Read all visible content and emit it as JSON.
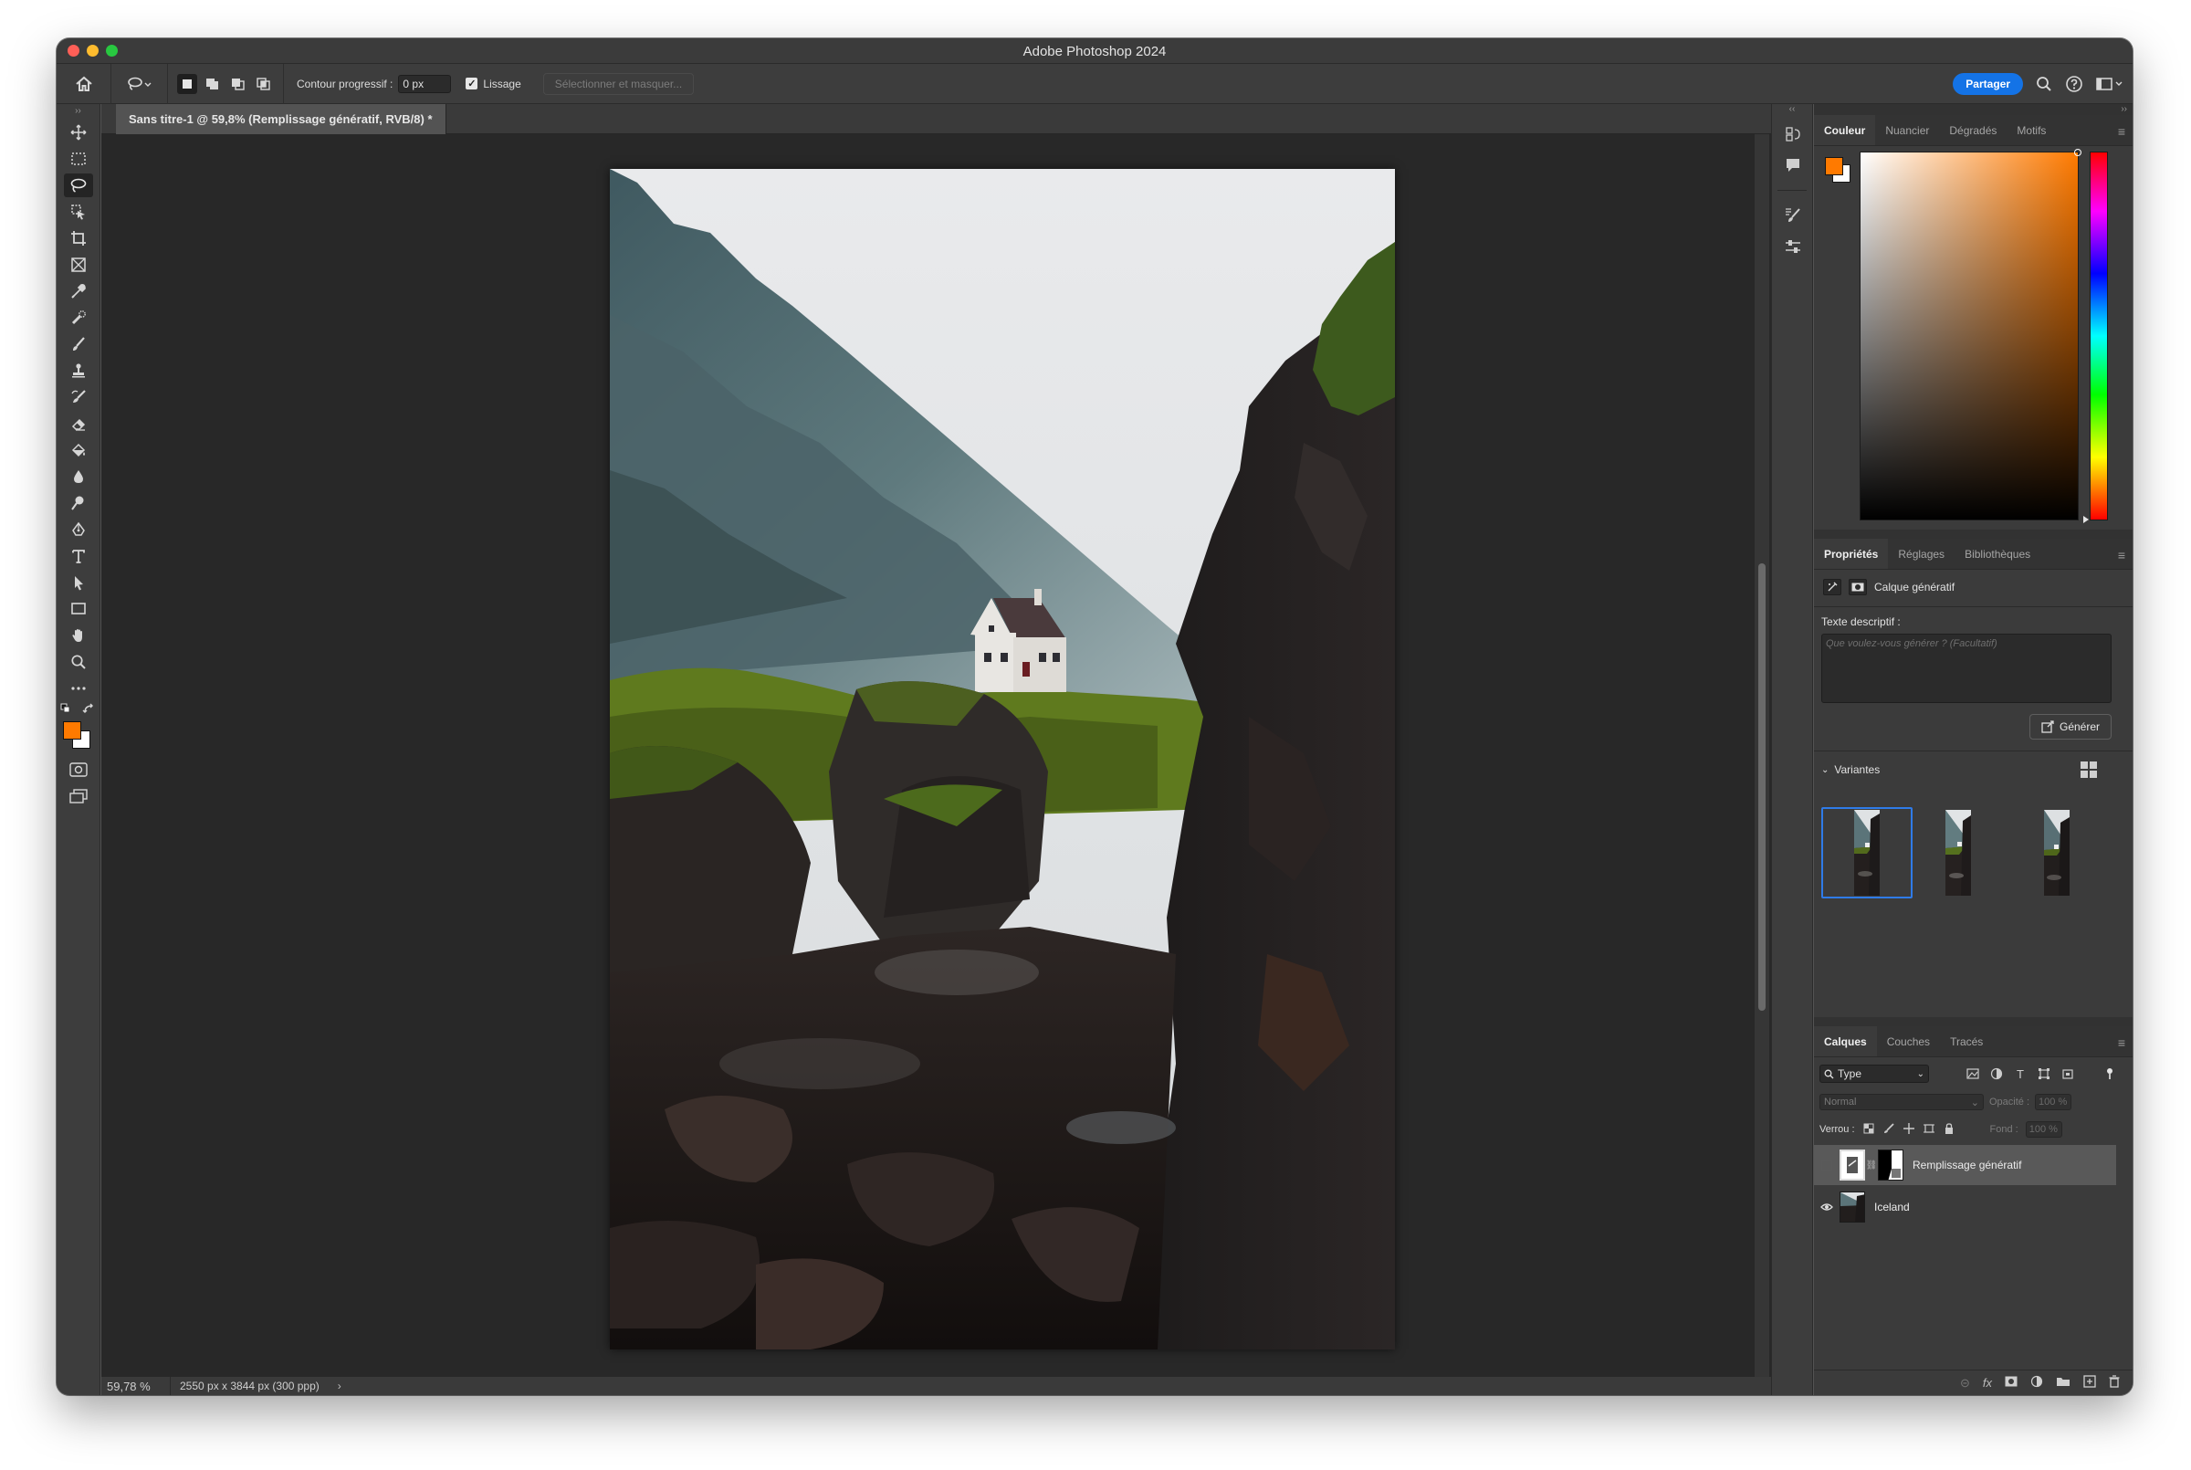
{
  "app": {
    "window_title": "Adobe Photoshop 2024"
  },
  "options_bar": {
    "feather_label": "Contour progressif :",
    "feather_value": "0 px",
    "antialias_label": "Lissage",
    "select_mask_label": "Sélectionner et masquer...",
    "share_label": "Partager"
  },
  "document": {
    "tab_title": "Sans titre-1 @ 59,8% (Remplissage génératif, RVB/8) *",
    "zoom": "59,78 %",
    "dimensions": "2550 px x 3844 px (300 ppp)",
    "status_arrow": "›"
  },
  "colors": {
    "foreground": "#ff7a00",
    "background": "#ffffff",
    "accent": "#1473e6"
  },
  "color_panel": {
    "tabs": [
      "Couleur",
      "Nuancier",
      "Dégradés",
      "Motifs"
    ],
    "active_tab": 0
  },
  "properties_panel": {
    "tabs": [
      "Propriétés",
      "Réglages",
      "Bibliothèques"
    ],
    "active_tab": 0,
    "layer_type": "Calque génératif",
    "prompt_label": "Texte descriptif :",
    "prompt_placeholder": "Que voulez-vous générer ?  (Facultatif)",
    "generate_label": "Générer",
    "variants_label": "Variantes",
    "variants_count": 3,
    "selected_variant": 0
  },
  "layers_panel": {
    "tabs": [
      "Calques",
      "Couches",
      "Tracés"
    ],
    "active_tab": 0,
    "filter_label": "Type",
    "blend_mode": "Normal",
    "opacity_label": "Opacité :",
    "opacity_value": "100 %",
    "lock_label": "Verrou :",
    "fill_label": "Fond :",
    "fill_value": "100 %",
    "layers": [
      {
        "name": "Remplissage génératif",
        "visible": false,
        "selected": true,
        "has_mask": true
      },
      {
        "name": "Iceland",
        "visible": true,
        "selected": false,
        "has_mask": false
      }
    ]
  },
  "icons": {
    "home": "home-icon",
    "lasso": "lasso-icon",
    "search": "search-icon",
    "help": "help-icon",
    "workspace": "workspace-icon"
  }
}
